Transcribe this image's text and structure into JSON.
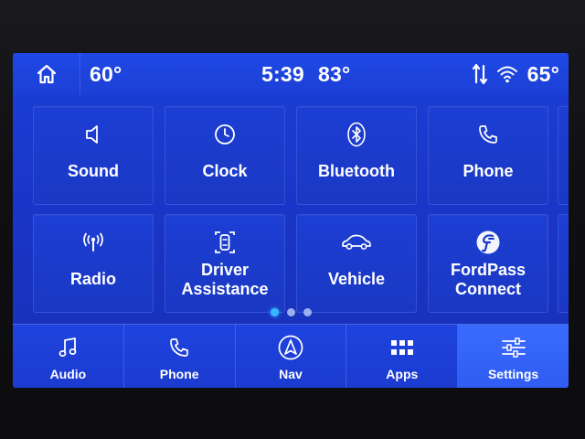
{
  "status_bar": {
    "outside_temp": "60°",
    "time": "5:39",
    "cabin_temp": "83°",
    "right_temp": "65°",
    "icons": [
      "home-icon",
      "data-transfer-icon",
      "wifi-icon"
    ]
  },
  "tiles": [
    {
      "label": "Sound",
      "icon": "speaker-icon"
    },
    {
      "label": "Clock",
      "icon": "clock-icon"
    },
    {
      "label": "Bluetooth",
      "icon": "bluetooth-icon"
    },
    {
      "label": "Phone",
      "icon": "phone-icon"
    },
    {
      "label": "Radio",
      "icon": "radio-antenna-icon"
    },
    {
      "label": "Driver\nAssistance",
      "icon": "driver-assist-icon"
    },
    {
      "label": "Vehicle",
      "icon": "car-icon"
    },
    {
      "label": "FordPass\nConnect",
      "icon": "fordpass-icon"
    }
  ],
  "pagination": {
    "pages": 3,
    "active": 0
  },
  "bottom_nav": [
    {
      "label": "Audio",
      "icon": "music-note-icon",
      "active": false
    },
    {
      "label": "Phone",
      "icon": "phone-icon",
      "active": false
    },
    {
      "label": "Nav",
      "icon": "navigation-arrow-icon",
      "active": false
    },
    {
      "label": "Apps",
      "icon": "apps-grid-icon",
      "active": false
    },
    {
      "label": "Settings",
      "icon": "sliders-icon",
      "active": true
    }
  ],
  "colors": {
    "screen_blue": "#1a36c8",
    "active_tab": "#3a6bff",
    "active_dot": "#37b6ff"
  }
}
